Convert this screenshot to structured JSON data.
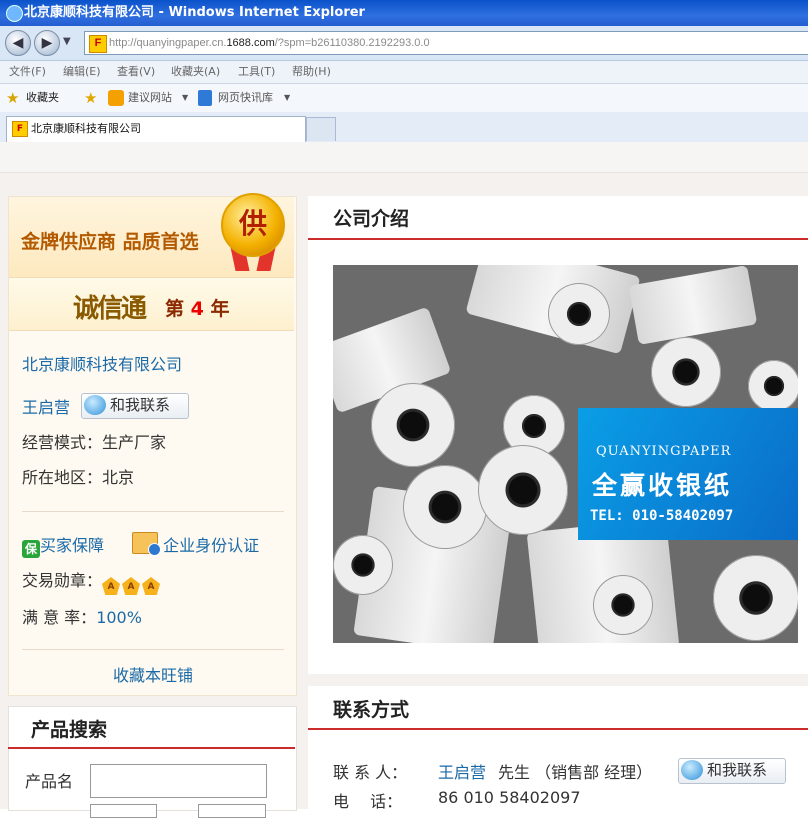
{
  "window": {
    "title": "北京康顺科技有限公司 - Windows Internet Explorer",
    "address_host_prefix": "http://quanyingpaper.cn.",
    "address_host_bold": "1688.com",
    "address_path": "/?spm=b26110380.2192293.0.0"
  },
  "menu": [
    "文件(F)",
    "编辑(E)",
    "查看(V)",
    "收藏夹(A)",
    "工具(T)",
    "帮助(H)"
  ],
  "favorites_bar": {
    "favorites": "收藏夹",
    "suggested_sites": "建议网站",
    "web_slice": "网页快讯库"
  },
  "tab": {
    "title": "北京康顺科技有限公司"
  },
  "left": {
    "gold_banner": "金牌供应商 品质首选",
    "medal_char": "供",
    "cxt_logo": "诚信通",
    "cxt_year_prefix": "第",
    "cxt_year_num": "4",
    "cxt_year_suffix": "年",
    "company": "北京康顺科技有限公司",
    "contact_name": "王启营",
    "talk_label": "和我联系",
    "biz_mode": "经营模式：生产厂家",
    "region": "所在地区：北京",
    "buyer_protect": "买家保障",
    "enterprise_id": "企业身份认证",
    "medal_label": "交易勋章：",
    "badge_letter": "A",
    "satisfaction_label": "满 意 率：",
    "satisfaction_value": "100%",
    "bookmark": "收藏本旺铺"
  },
  "search": {
    "title": "产品搜索",
    "product_name_label": "产品名"
  },
  "company_intro": {
    "title": "公司介绍",
    "photo_brand_en": "QUANYINGPAPER",
    "photo_brand_cn": "全赢收银纸",
    "photo_tel": "TEL: 010-58402097"
  },
  "contact": {
    "title": "联系方式",
    "person_label": "联 系 人：",
    "person_name": "王启营",
    "person_suffix": "先生 （销售部 经理）",
    "talk_label": "和我联系",
    "phone_label": "电　 话：",
    "phone_value": "86 010 58402097"
  },
  "colors": {
    "accent_red": "#cc2b2b",
    "link_blue": "#1a6aa8",
    "photo_blue": "#0a8ad8"
  }
}
